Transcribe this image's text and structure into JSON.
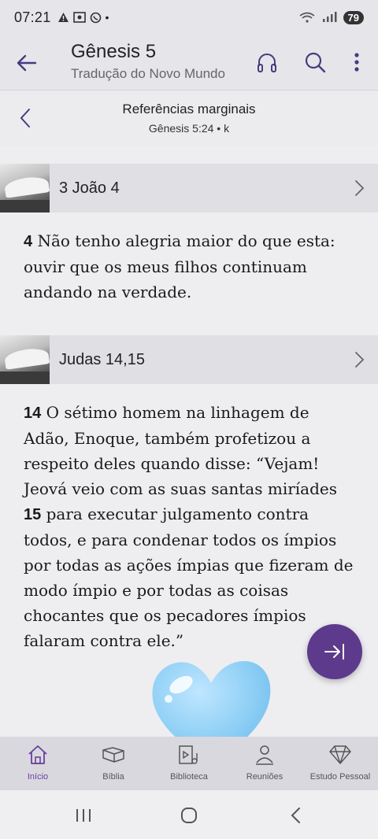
{
  "status_bar": {
    "time": "07:21",
    "battery": "79",
    "dot": "•"
  },
  "header": {
    "title": "Gênesis 5",
    "subtitle": "Tradução do Novo Mundo"
  },
  "ref_bar": {
    "title": "Referências marginais",
    "subtitle": "Gênesis 5:24 • k"
  },
  "references": [
    {
      "label": "3 João 4",
      "verse_num": "4",
      "text": " Não tenho alegria maior do que esta: ouvir que os meus filhos continuam andando na verdade."
    },
    {
      "label": "Judas 14,15",
      "verse_num_a": "14",
      "text_a": " O sétimo homem na linhagem de Adão, Enoque, também profetizou a respeito deles quando disse: “Vejam! Jeová veio com as suas santas miríades ",
      "verse_num_b": "15",
      "text_b": " para executar julgamento contra todos, e para condenar todos os ímpios por todas as ações ímpias que fizeram de modo ímpio e por todas as coisas chocantes que os pecadores ímpios falaram contra ele.”"
    }
  ],
  "nav": [
    {
      "label": "Início",
      "icon": "home-icon",
      "active": true
    },
    {
      "label": "Bíblia",
      "icon": "bible-icon",
      "active": false
    },
    {
      "label": "Biblioteca",
      "icon": "library-icon",
      "active": false
    },
    {
      "label": "Reuniões",
      "icon": "meetings-icon",
      "active": false
    },
    {
      "label": "Estudo Pessoal",
      "icon": "diamond-icon",
      "active": false
    }
  ],
  "colors": {
    "accent": "#6a3fa0",
    "fab": "#5d3a8c",
    "heart": "#8ecff5"
  }
}
